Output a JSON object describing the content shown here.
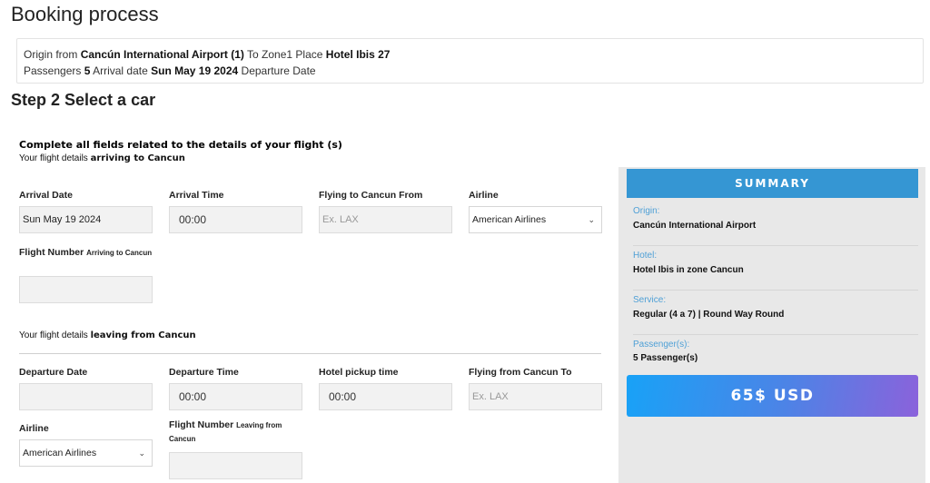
{
  "page": {
    "title": "Booking process",
    "step_title": "Step 2 Select a car"
  },
  "info": {
    "origin_prefix": "Origin from",
    "origin": "Cancún International Airport (1)",
    "to_prefix": "To Zone1 Place",
    "place": "Hotel Ibis 27",
    "passengers_prefix": "Passengers",
    "passengers": "5",
    "arrival_prefix": "Arrival date",
    "arrival_date": "Sun May 19 2024",
    "departure_prefix": "Departure Date"
  },
  "form": {
    "heading": "Complete all fields related to the details of your flight (s)",
    "arriving_prefix": "Your flight details",
    "arriving_bold": "arriving to Cancun",
    "arrival": {
      "date_label": "Arrival Date",
      "date_value": "Sun May 19 2024",
      "time_label": "Arrival Time",
      "time_value": "00:00",
      "from_label": "Flying to Cancun From",
      "from_placeholder": "Ex. LAX",
      "airline_label": "Airline",
      "airline_value": "American Airlines",
      "flight_label": "Flight Number",
      "flight_label_small": "Arriving to Cancun",
      "flight_value": ""
    },
    "leaving_prefix": "Your flight details",
    "leaving_bold": "leaving from Cancun",
    "departure": {
      "date_label": "Departure Date",
      "date_value": "",
      "time_label": "Departure Time",
      "time_value": "00:00",
      "pickup_label": "Hotel pickup time",
      "pickup_value": "00:00",
      "to_label": "Flying from Cancun To",
      "to_placeholder": "Ex. LAX",
      "airline_label": "Airline",
      "airline_value": "American Airlines",
      "flight_label": "Flight Number",
      "flight_label_small": "Leaving from Cancun",
      "flight_value": ""
    }
  },
  "summary": {
    "title": "SUMMARY",
    "items": [
      {
        "label": "Origin:",
        "value": "Cancún International Airport"
      },
      {
        "label": "Hotel:",
        "value": "Hotel Ibis in zone Cancun"
      },
      {
        "label": "Service:",
        "value": "Regular (4 a 7) | Round Way Round"
      },
      {
        "label": "Passenger(s):",
        "value": "5 Passenger(s)"
      }
    ],
    "price": "65$ USD"
  },
  "colors": {
    "summary_header": "#3596d3",
    "summary_label": "#4fa0d6",
    "panel_bg": "#e8e8e8",
    "price_gradient_start": "#18a2f7",
    "price_gradient_end": "#8b62db"
  },
  "icons": {
    "select_chevron": "chevron-down-icon"
  }
}
